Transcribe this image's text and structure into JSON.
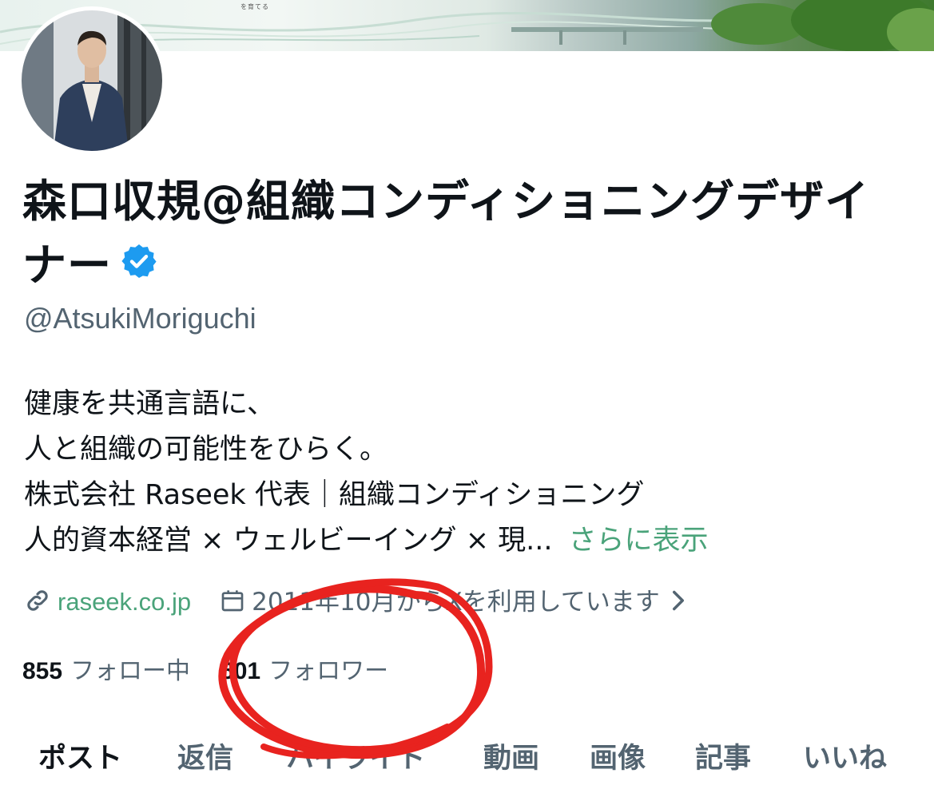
{
  "banner": {
    "caption": "を育てる"
  },
  "profile": {
    "name": "森口収規@組織コンディショニングデザイナー",
    "verified": true,
    "handle": "@AtsukiMoriguchi",
    "bio_lines": [
      "健康を共通言語に、",
      "人と組織の可能性をひらく。",
      "株式会社 Raseek 代表｜組織コンディショニング",
      "人的資本経営 × ウェルビーイング × 現..."
    ],
    "show_more": "さらに表示",
    "website": "raseek.co.jp",
    "joined": "2011年10月からXを利用しています"
  },
  "stats": {
    "following_count": "855",
    "following_label": "フォロー中",
    "followers_count": "601",
    "followers_label": "フォロワー"
  },
  "tabs": [
    {
      "label": "ポスト",
      "active": true
    },
    {
      "label": "返信"
    },
    {
      "label": "ハイライト"
    },
    {
      "label": "動画"
    },
    {
      "label": "画像"
    },
    {
      "label": "記事"
    },
    {
      "label": "いいね"
    }
  ],
  "colors": {
    "accent_link": "#4aa37a",
    "verified_badge": "#1d9bf0",
    "annotation": "#e8231f",
    "text_primary": "#0f1419",
    "text_secondary": "#536471"
  },
  "icons": {
    "verified": "verified-badge-icon",
    "link": "link-icon",
    "calendar": "calendar-icon",
    "chevron": "chevron-right-icon"
  }
}
